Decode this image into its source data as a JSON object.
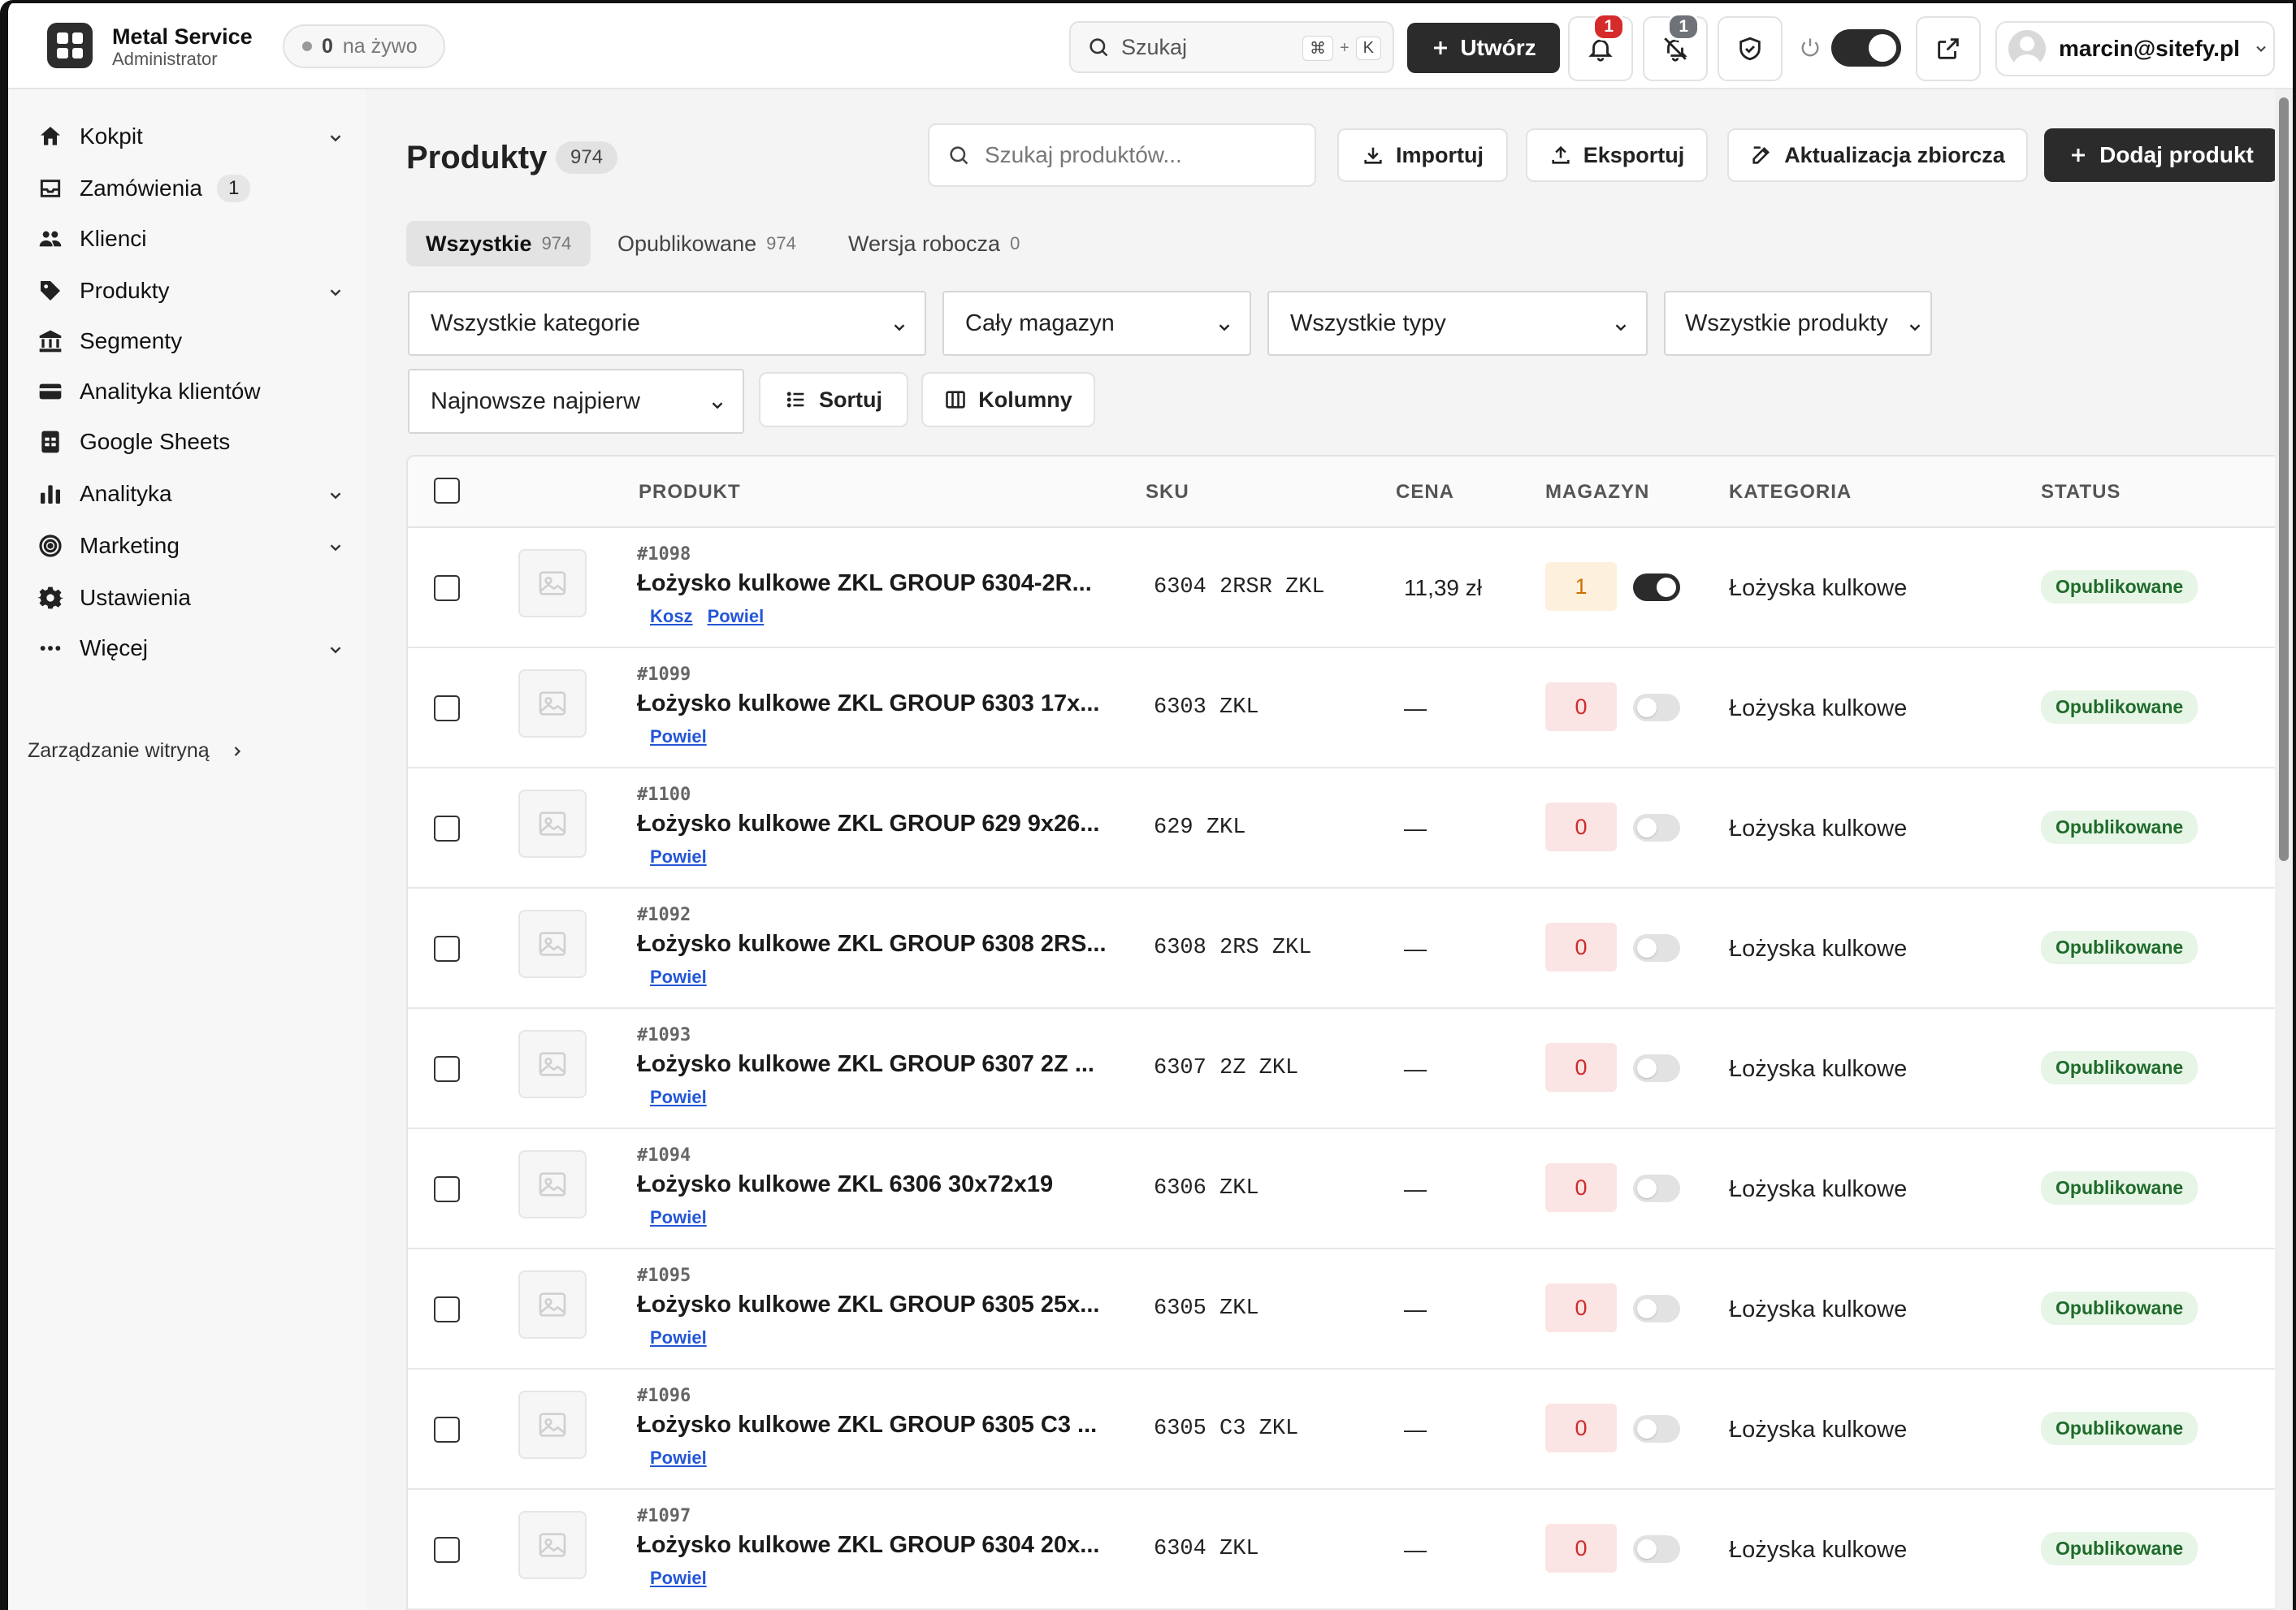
{
  "app": {
    "brand_name": "Metal Service",
    "brand_role": "Administrator",
    "live_count": "0",
    "live_label": "na żywo",
    "search_placeholder": "Szukaj",
    "shortcut_mod": "⌘",
    "shortcut_plus": "+",
    "shortcut_key": "K",
    "create_label": "Utwórz",
    "notifications_count": "1",
    "muted_count": "1",
    "user_email": "marcin@sitefy.pl"
  },
  "sidebar": {
    "items": [
      {
        "label": "Kokpit",
        "icon": "home-icon",
        "has_chevron": true
      },
      {
        "label": "Zamówienia",
        "icon": "inbox-icon",
        "count": "1"
      },
      {
        "label": "Klienci",
        "icon": "users-icon"
      },
      {
        "label": "Produkty",
        "icon": "tag-icon",
        "has_chevron": true
      },
      {
        "label": "Segmenty",
        "icon": "bank-icon"
      },
      {
        "label": "Analityka klientów",
        "icon": "card-icon"
      },
      {
        "label": "Google Sheets",
        "icon": "sheet-icon"
      },
      {
        "label": "Analityka",
        "icon": "bar-chart-icon",
        "has_chevron": true
      },
      {
        "label": "Marketing",
        "icon": "target-icon",
        "has_chevron": true
      },
      {
        "label": "Ustawienia",
        "icon": "gear-icon"
      },
      {
        "label": "Więcej",
        "icon": "more-icon",
        "has_chevron": true
      }
    ],
    "site_management": "Zarządzanie witryną"
  },
  "page": {
    "title": "Produkty",
    "title_count": "974",
    "search_placeholder": "Szukaj produktów...",
    "import_label": "Importuj",
    "export_label": "Eksportuj",
    "bulk_update_label": "Aktualizacja zbiorcza",
    "add_product_label": "Dodaj produkt"
  },
  "tabs": [
    {
      "label": "Wszystkie",
      "count": "974",
      "active": true
    },
    {
      "label": "Opublikowane",
      "count": "974"
    },
    {
      "label": "Wersja robocza",
      "count": "0"
    }
  ],
  "filters": {
    "category": "Wszystkie kategorie",
    "warehouse": "Cały magazyn",
    "type": "Wszystkie typy",
    "products": "Wszystkie produkty",
    "order": "Najnowsze najpierw",
    "sort_label": "Sortuj",
    "columns_label": "Kolumny"
  },
  "table": {
    "headers": {
      "product": "PRODUKT",
      "sku": "SKU",
      "price": "CENA",
      "stock": "MAGAZYN",
      "category": "KATEGORIA",
      "status": "STATUS"
    },
    "rows": [
      {
        "id": "#1098",
        "name": "Łożysko kulkowe ZKL GROUP 6304-2R...",
        "links": [
          "Kosz",
          "Powiel"
        ],
        "sku": "6304 2RSR ZKL",
        "price": "11,39 zł",
        "stock": "1",
        "active": true,
        "category": "Łożyska kulkowe",
        "status": "Opublikowane"
      },
      {
        "id": "#1099",
        "name": "Łożysko kulkowe ZKL GROUP 6303 17x...",
        "links": [
          "Powiel"
        ],
        "sku": "6303 ZKL",
        "price": "—",
        "stock": "0",
        "active": false,
        "category": "Łożyska kulkowe",
        "status": "Opublikowane"
      },
      {
        "id": "#1100",
        "name": "Łożysko kulkowe ZKL GROUP 629 9x26...",
        "links": [
          "Powiel"
        ],
        "sku": "629 ZKL",
        "price": "—",
        "stock": "0",
        "active": false,
        "category": "Łożyska kulkowe",
        "status": "Opublikowane"
      },
      {
        "id": "#1092",
        "name": "Łożysko kulkowe ZKL GROUP 6308 2RS...",
        "links": [
          "Powiel"
        ],
        "sku": "6308 2RS ZKL",
        "price": "—",
        "stock": "0",
        "active": false,
        "category": "Łożyska kulkowe",
        "status": "Opublikowane"
      },
      {
        "id": "#1093",
        "name": "Łożysko kulkowe ZKL GROUP 6307 2Z ...",
        "links": [
          "Powiel"
        ],
        "sku": "6307 2Z ZKL",
        "price": "—",
        "stock": "0",
        "active": false,
        "category": "Łożyska kulkowe",
        "status": "Opublikowane"
      },
      {
        "id": "#1094",
        "name": "Łożysko kulkowe ZKL 6306 30x72x19",
        "links": [
          "Powiel"
        ],
        "sku": "6306 ZKL",
        "price": "—",
        "stock": "0",
        "active": false,
        "category": "Łożyska kulkowe",
        "status": "Opublikowane"
      },
      {
        "id": "#1095",
        "name": "Łożysko kulkowe ZKL GROUP 6305 25x...",
        "links": [
          "Powiel"
        ],
        "sku": "6305 ZKL",
        "price": "—",
        "stock": "0",
        "active": false,
        "category": "Łożyska kulkowe",
        "status": "Opublikowane"
      },
      {
        "id": "#1096",
        "name": "Łożysko kulkowe ZKL GROUP 6305 C3 ...",
        "links": [
          "Powiel"
        ],
        "sku": "6305 C3 ZKL",
        "price": "—",
        "stock": "0",
        "active": false,
        "category": "Łożyska kulkowe",
        "status": "Opublikowane"
      },
      {
        "id": "#1097",
        "name": "Łożysko kulkowe ZKL GROUP 6304 20x...",
        "links": [
          "Powiel"
        ],
        "sku": "6304 ZKL",
        "price": "—",
        "stock": "0",
        "active": false,
        "category": "Łożyska kulkowe",
        "status": "Opublikowane"
      }
    ]
  },
  "colors": {
    "dark": "#2b2b2b",
    "badge_red": "#d62b2b",
    "link_blue": "#2456d6",
    "status_bg": "#e6f5e6",
    "status_fg": "#1f6b2a",
    "stock_zero_bg": "#fbe4e4",
    "stock_low_bg": "#fdf0dd"
  }
}
